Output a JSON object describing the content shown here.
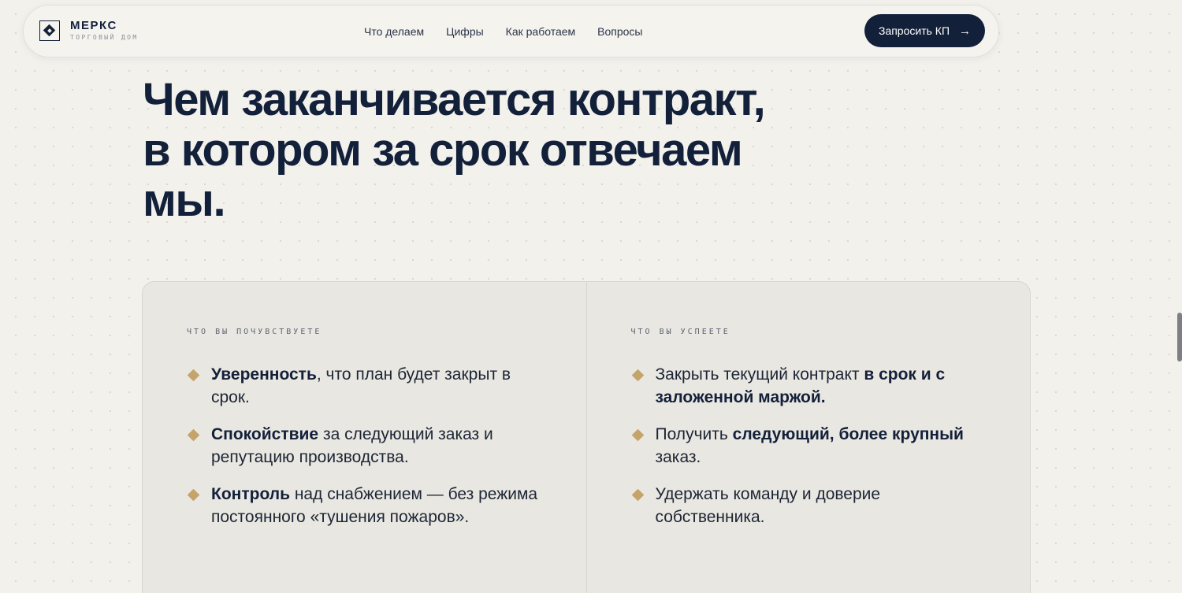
{
  "header": {
    "brand_name": "МЕРКС",
    "brand_sub": "ТОРГОВЫЙ ДОМ",
    "nav": [
      "Что делаем",
      "Цифры",
      "Как работаем",
      "Вопросы"
    ],
    "cta_label": "Запросить КП",
    "cta_arrow": "→"
  },
  "hero": {
    "title_lines": [
      "Чем заканчивается контракт,",
      "в котором за срок отвечаем",
      "мы."
    ]
  },
  "card": {
    "left": {
      "label": "ЧТО ВЫ ПОЧУВСТВУЕТЕ",
      "items": [
        {
          "bold": "Уверенность",
          "rest": ", что план будет закрыт в срок."
        },
        {
          "bold": "Спокойствие",
          "rest": " за следующий заказ и репутацию производства."
        },
        {
          "bold": "Контроль",
          "rest": " над снабжением — без режима постоянного «тушения пожаров»."
        }
      ]
    },
    "right": {
      "label": "ЧТО ВЫ УСПЕЕТЕ",
      "items": [
        {
          "pre": "Закрыть текущий контракт ",
          "bold": "в срок и с заложенной маржой",
          "post": "."
        },
        {
          "pre": "Получить ",
          "bold": "следующий, более крупный",
          "post": " заказ."
        },
        {
          "pre": "Удержать команду и доверие собственника.",
          "bold": "",
          "post": ""
        }
      ]
    }
  },
  "colors": {
    "navy": "#13203a",
    "gold": "#c4a46a",
    "background": "#f2f1ec",
    "card": "#e9e7e1"
  }
}
